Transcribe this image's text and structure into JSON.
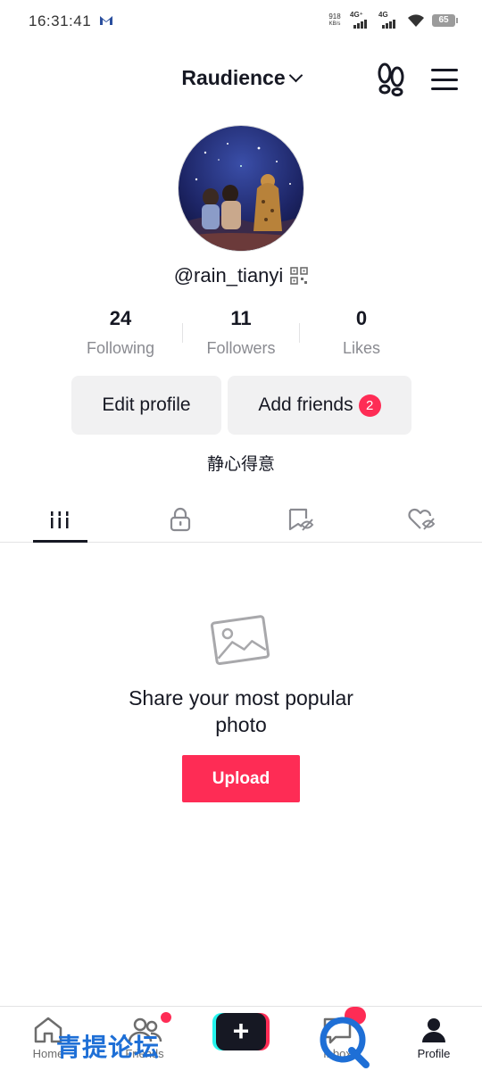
{
  "status_bar": {
    "time": "16:31:41",
    "net_speed_value": "918",
    "net_speed_unit": "KB/s",
    "signal1_label": "4G⁺",
    "signal2_label": "4G",
    "battery": "65"
  },
  "header": {
    "title": "Raudience"
  },
  "profile": {
    "username": "@rain_tianyi",
    "bio": "静心得意"
  },
  "stats": [
    {
      "value": "24",
      "label": "Following"
    },
    {
      "value": "11",
      "label": "Followers"
    },
    {
      "value": "0",
      "label": "Likes"
    }
  ],
  "buttons": {
    "edit_profile": "Edit profile",
    "add_friends": "Add friends",
    "add_friends_badge": "2"
  },
  "tabs": [
    {
      "icon": "grid-icon",
      "active": true
    },
    {
      "icon": "lock-icon",
      "active": false
    },
    {
      "icon": "hidden-bookmark-icon",
      "active": false
    },
    {
      "icon": "hidden-heart-icon",
      "active": false
    }
  ],
  "empty_state": {
    "line1": "Share your most popular",
    "line2": "photo",
    "upload_label": "Upload"
  },
  "bottom_nav": {
    "home": "Home",
    "friends": "Friends",
    "inbox": "Inbox",
    "profile": "Profile"
  },
  "watermark": {
    "text": "青提论坛"
  },
  "colors": {
    "accent": "#fe2c55",
    "cyan": "#25f4ee",
    "text": "#161823",
    "muted": "#8a8b91",
    "watermark_blue": "#1e6fd6"
  }
}
